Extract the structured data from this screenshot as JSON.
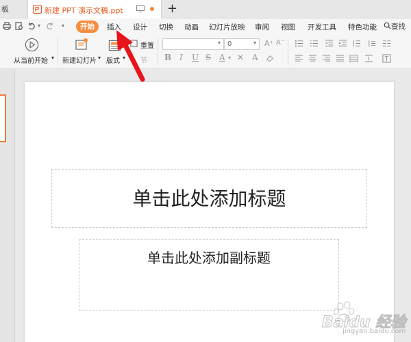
{
  "tabs": {
    "prev_label": "板",
    "active_title": "新建 PPT 演示文稿.ppt",
    "add_label": "+"
  },
  "menu": {
    "start": "开始",
    "items": [
      "插入",
      "设计",
      "切换",
      "动画",
      "幻灯片放映",
      "审阅",
      "视图",
      "开发工具",
      "特色功能"
    ],
    "search": "查找"
  },
  "ribbon": {
    "play_from_current": "从当前开始",
    "new_slide": "新建幻灯片",
    "layout": "版式",
    "reset": "重置",
    "section": "节",
    "font_size": "0",
    "format_buttons": [
      "B",
      "I",
      "U",
      "S",
      "X²",
      "X₂",
      "A",
      "A",
      "✕"
    ]
  },
  "slide": {
    "title_placeholder": "单击此处添加标题",
    "subtitle_placeholder": "单击此处添加副标题"
  },
  "watermark": {
    "text": "Baidu 经验",
    "sub": "jingyan.baidu.com"
  },
  "colors": {
    "accent": "#f58d3f",
    "arrow": "#e8141b"
  }
}
